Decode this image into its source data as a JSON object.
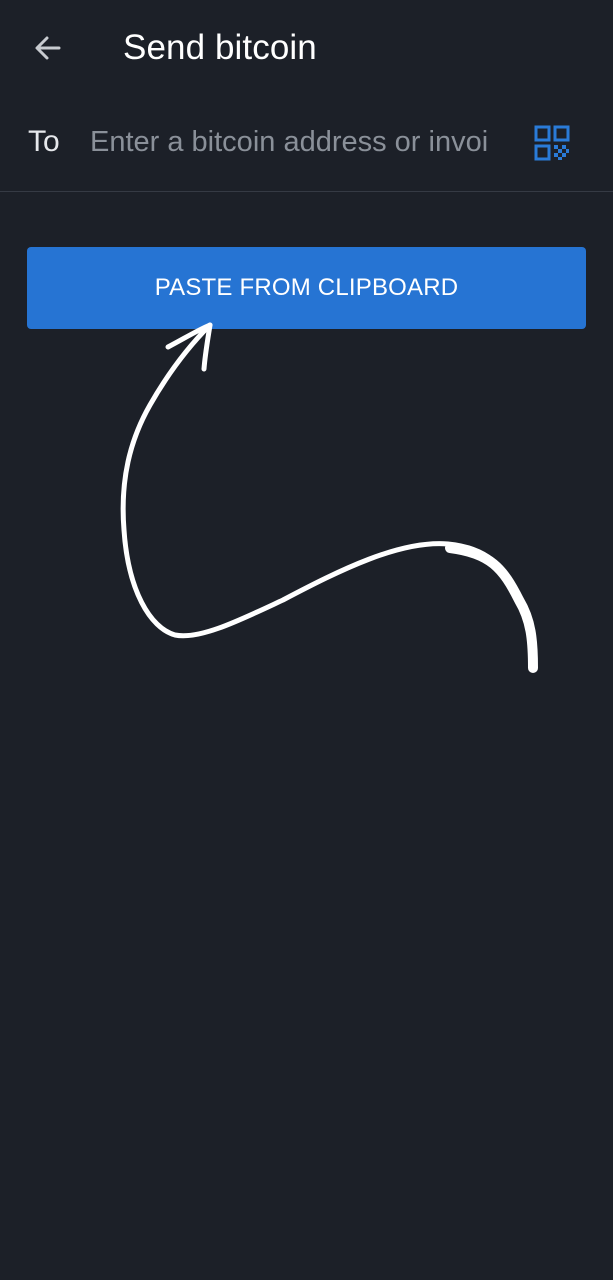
{
  "app_bar": {
    "back_icon": "arrow-left-icon",
    "title": "Send bitcoin"
  },
  "recipient": {
    "label": "To",
    "value": "",
    "placeholder": "Enter a bitcoin address or invoi",
    "qr_icon": "qr-code-icon"
  },
  "actions": {
    "paste_label": "PASTE FROM CLIPBOARD"
  },
  "colors": {
    "background": "#1c2028",
    "accent": "#2674d3",
    "qr_icon": "#2a7bd8",
    "placeholder": "#8a9099"
  },
  "annotation": {
    "type": "hand-drawn-arrow",
    "color": "#ffffff",
    "points_to": "paste-button"
  }
}
